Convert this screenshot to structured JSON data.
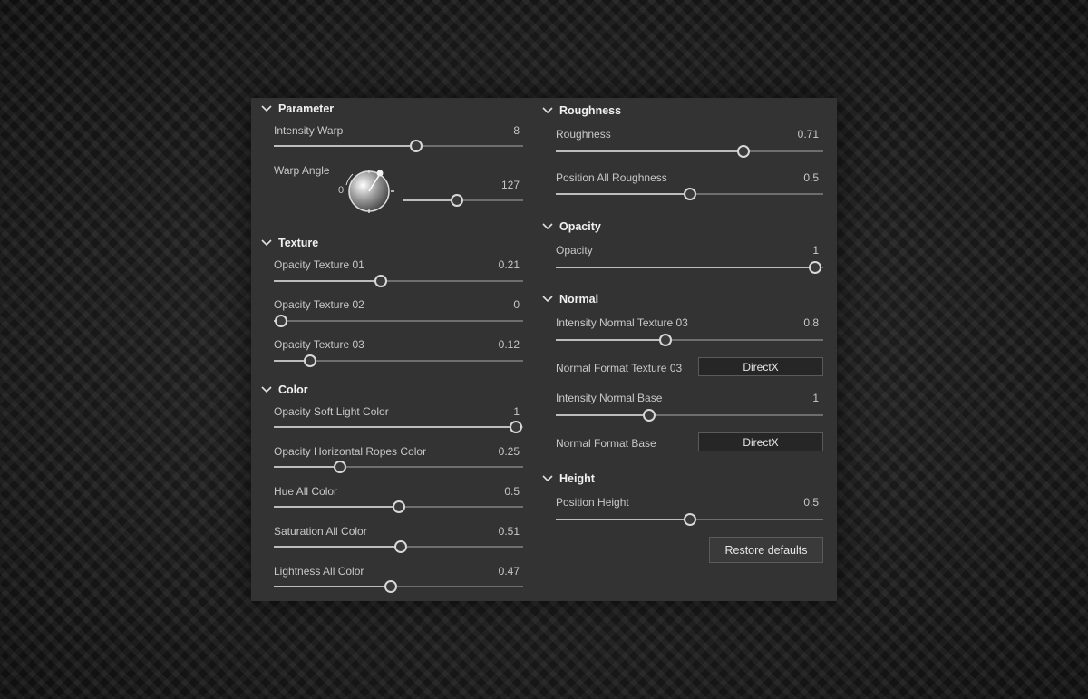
{
  "parameter": {
    "title": "Parameter",
    "intensity_warp": {
      "label": "Intensity Warp",
      "value": "8",
      "level": 0.57
    },
    "warp_angle": {
      "label": "Warp Angle",
      "dial_zero": "0",
      "value": "127",
      "level": 0.45
    }
  },
  "texture": {
    "title": "Texture",
    "sliders": [
      {
        "label": "Opacity Texture 01",
        "value": "0.21",
        "level": 0.43
      },
      {
        "label": "Opacity Texture 02",
        "value": "0",
        "level": 0.03
      },
      {
        "label": "Opacity Texture 03",
        "value": "0.12",
        "level": 0.145
      }
    ]
  },
  "color": {
    "title": "Color",
    "sliders": [
      {
        "label": "Opacity  Soft Light Color",
        "value": "1",
        "level": 0.97
      },
      {
        "label": "Opacity Horizontal Ropes Color",
        "value": "0.25",
        "level": 0.265
      },
      {
        "label": "Hue All Color",
        "value": "0.5",
        "level": 0.5
      },
      {
        "label": "Saturation All Color",
        "value": "0.51",
        "level": 0.51
      },
      {
        "label": "Lightness All Color",
        "value": "0.47",
        "level": 0.47
      }
    ]
  },
  "roughness": {
    "title": "Roughness",
    "sliders": [
      {
        "label": "Roughness",
        "value": "0.71",
        "level": 0.7
      },
      {
        "label": "Position All Roughness",
        "value": "0.5",
        "level": 0.5
      }
    ]
  },
  "opacity": {
    "title": "Opacity",
    "sliders": [
      {
        "label": "Opacity",
        "value": "1",
        "level": 0.97
      }
    ]
  },
  "normal": {
    "title": "Normal",
    "intensity_texture": {
      "label": "Intensity Normal Texture 03",
      "value": "0.8",
      "level": 0.41
    },
    "format_texture": {
      "label": "Normal Format Texture 03",
      "value": "DirectX"
    },
    "intensity_base": {
      "label": "Intensity Normal Base",
      "value": "1",
      "level": 0.35
    },
    "format_base": {
      "label": "Normal Format Base",
      "value": "DirectX"
    }
  },
  "height": {
    "title": "Height",
    "sliders": [
      {
        "label": "Position Height",
        "value": "0.5",
        "level": 0.5
      }
    ]
  },
  "restore_label": "Restore defaults",
  "colors": {
    "panel": "#333333",
    "track": "#6e6e6e",
    "thumb": "#d8d8d8"
  }
}
